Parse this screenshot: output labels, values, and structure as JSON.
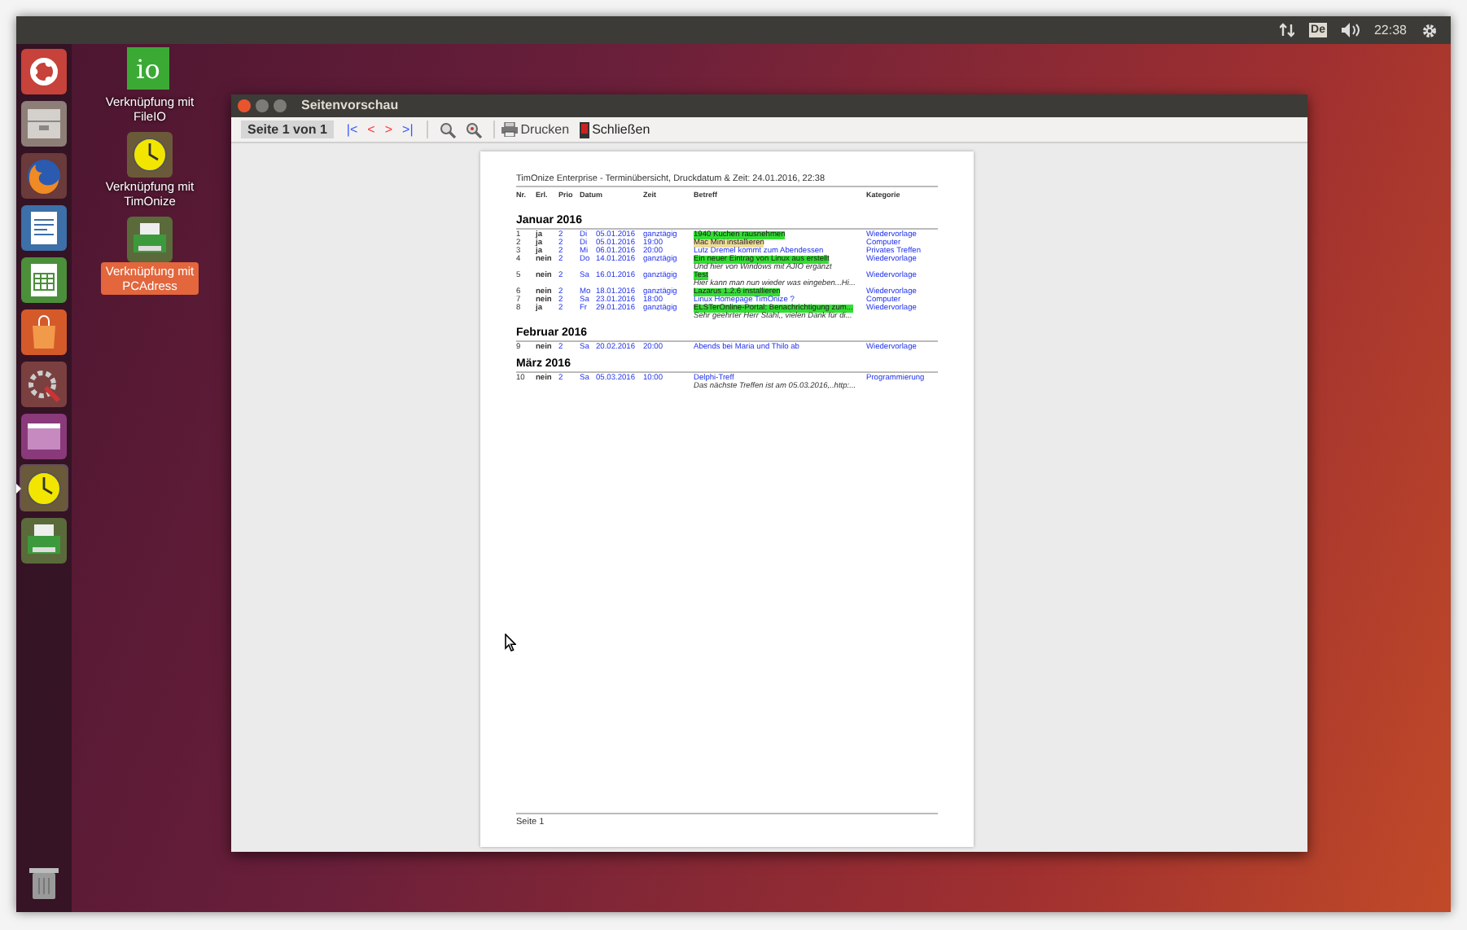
{
  "top_panel": {
    "keyboard": "De",
    "time": "22:38"
  },
  "launcher": [
    {
      "kind": "ubuntu",
      "selected": false
    },
    {
      "kind": "files",
      "selected": false
    },
    {
      "kind": "firefox",
      "selected": false
    },
    {
      "kind": "writer",
      "selected": false
    },
    {
      "kind": "calc",
      "selected": false
    },
    {
      "kind": "software",
      "selected": false
    },
    {
      "kind": "settings",
      "selected": false
    },
    {
      "kind": "window",
      "selected": false
    },
    {
      "kind": "clock",
      "selected": true
    },
    {
      "kind": "printer",
      "selected": false
    }
  ],
  "desktop_icons": [
    {
      "kind": "io",
      "label": "Verknüpfung mit FileIO",
      "selected": false
    },
    {
      "kind": "clock",
      "label": "Verknüpfung mit TimOnize",
      "selected": false
    },
    {
      "kind": "printer",
      "label": "Verknüpfung mit PCAdress",
      "selected": true
    }
  ],
  "window": {
    "title": "Seitenvorschau"
  },
  "toolbar": {
    "page_label": "Seite 1 von 1",
    "nav": [
      {
        "label": "|<",
        "color": "#3355ff"
      },
      {
        "label": "<",
        "color": "#ff3333"
      },
      {
        "label": ">",
        "color": "#ff3333"
      },
      {
        "label": ">|",
        "color": "#3355ff"
      }
    ],
    "print": "Drucken",
    "close": "Schließen"
  },
  "document": {
    "header": "TimOnize Enterprise - Terminübersicht, Druckdatum & Zeit: 24.01.2016, 22:38",
    "columns": [
      "Nr.",
      "Erl.",
      "Prio",
      "Datum",
      "Zeit",
      "Betreff",
      "Kategorie"
    ],
    "months": [
      {
        "title": "Januar 2016",
        "rows": [
          {
            "nr": "1",
            "done": "ja",
            "prio": "2",
            "day": "Di",
            "date": "05.01.2016",
            "time": "ganztägig",
            "subject": "1940 Kuchen rausnehmen",
            "color": "#33dd33",
            "category": "Wiedervorlage"
          },
          {
            "nr": "2",
            "done": "ja",
            "prio": "2",
            "day": "Di",
            "date": "05.01.2016",
            "time": "19:00",
            "subject": "Mac Mini installieren",
            "color": "#eedd99",
            "category": "Computer"
          },
          {
            "nr": "3",
            "done": "ja",
            "prio": "2",
            "day": "Mi",
            "date": "06.01.2016",
            "time": "20:00",
            "subject": "Lutz Dremel kommt zum Abendessen",
            "category": "Privates Treffen"
          },
          {
            "nr": "4",
            "done": "nein",
            "prio": "2",
            "day": "Do",
            "date": "14.01.2016",
            "time": "ganztägig",
            "subject": "Ein neuer Eintrag von Linux aus erstellt",
            "color": "#33dd33",
            "category": "Wiedervorlage",
            "note": "Und hier von Windows mit AJIO ergänzt"
          },
          {
            "nr": "5",
            "done": "nein",
            "prio": "2",
            "day": "Sa",
            "date": "16.01.2016",
            "time": "ganztägig",
            "subject": "Test",
            "color": "#33dd33",
            "category": "Wiedervorlage",
            "note": "Hier kann man nun wieder was eingeben...Hi..."
          },
          {
            "nr": "6",
            "done": "nein",
            "prio": "2",
            "day": "Mo",
            "date": "18.01.2016",
            "time": "ganztägig",
            "subject": "Lazarus 1.2.6 installieren",
            "color": "#33dd33",
            "category": "Wiedervorlage"
          },
          {
            "nr": "7",
            "done": "nein",
            "prio": "2",
            "day": "Sa",
            "date": "23.01.2016",
            "time": "18:00",
            "subject": "Linux Homepage TimOnize ?",
            "category": "Computer"
          },
          {
            "nr": "8",
            "done": "ja",
            "prio": "2",
            "day": "Fr",
            "date": "29.01.2016",
            "time": "ganztägig",
            "subject": "ELSTerOnline-Portal: Benachrichtigung zum...",
            "color": "#33dd33",
            "category": "Wiedervorlage",
            "note": "Sehr geehrter Herr Stahl,, vielen Dank für di..."
          }
        ]
      },
      {
        "title": "Februar 2016",
        "rows": [
          {
            "nr": "9",
            "done": "nein",
            "prio": "2",
            "day": "Sa",
            "date": "20.02.2016",
            "time": "20:00",
            "subject": "Abends bei Maria und Thilo ab",
            "category": "Wiedervorlage"
          }
        ]
      },
      {
        "title": "März 2016",
        "rows": [
          {
            "nr": "10",
            "done": "nein",
            "prio": "2",
            "day": "Sa",
            "date": "05.03.2016",
            "time": "10:00",
            "subject": "Delphi-Treff",
            "category": "Programmierung",
            "note": "Das nächste Treffen ist am 05.03.2016,..http:..."
          }
        ]
      }
    ],
    "footer": "Seite 1"
  }
}
